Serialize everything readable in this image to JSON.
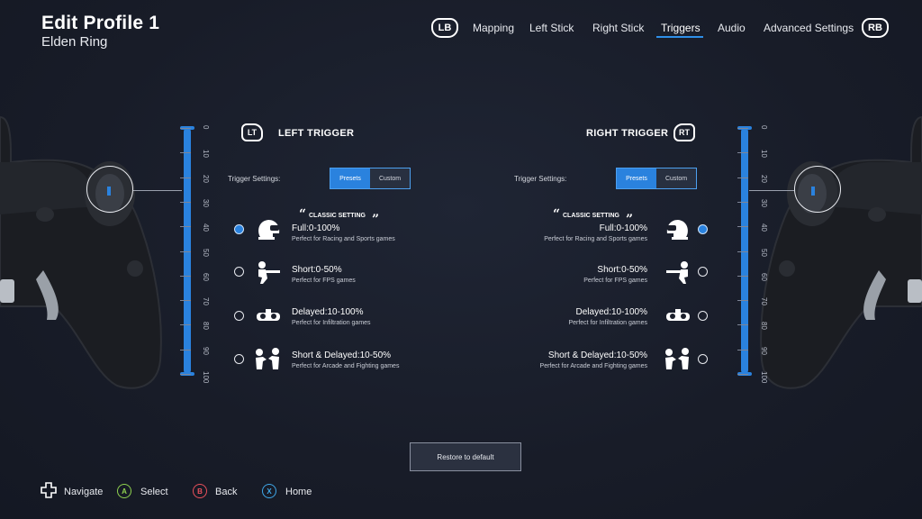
{
  "header": {
    "title": "Edit Profile 1",
    "subtitle": "Elden Ring",
    "lb": "LB",
    "rb": "RB",
    "tabs": [
      {
        "label": "Mapping"
      },
      {
        "label": "Left Stick"
      },
      {
        "label": "Right Stick"
      },
      {
        "label": "Triggers",
        "active": true
      },
      {
        "label": "Audio"
      },
      {
        "label": "Advanced Settings"
      }
    ]
  },
  "scale": [
    "0",
    "10",
    "20",
    "30",
    "40",
    "50",
    "60",
    "70",
    "80",
    "90",
    "100"
  ],
  "left": {
    "badge": "LT",
    "title": "LEFT TRIGGER",
    "settings_label": "Trigger Settings:",
    "presets": "Presets",
    "custom": "Custom",
    "range": [
      0,
      100
    ]
  },
  "right": {
    "badge": "RT",
    "title": "RIGHT TRIGGER",
    "settings_label": "Trigger Settings:",
    "presets": "Presets",
    "custom": "Custom",
    "range": [
      0,
      100
    ]
  },
  "classic_label": "CLASSIC SETTING",
  "options": [
    {
      "title": "Full:0-100%",
      "desc": "Perfect for Racing and Sports games",
      "icon": "racing-helmet-icon"
    },
    {
      "title": "Short:0-50%",
      "desc": "Perfect for FPS games",
      "icon": "soldier-rifle-icon"
    },
    {
      "title": "Delayed:10-100%",
      "desc": "Perfect for Infiltration games",
      "icon": "night-goggles-icon"
    },
    {
      "title": "Short  & Delayed:10-50%",
      "desc": "Perfect for Arcade and Fighting games",
      "icon": "fighters-icon"
    }
  ],
  "right_options": [
    {
      "title": "Full:0-100%"
    },
    {
      "title": "Short:0-50%"
    },
    {
      "title": "Delayed:10-100%"
    },
    {
      "title": "Short  & Delayed:10-50%"
    }
  ],
  "selected_option": 0,
  "restore": "Restore to default",
  "footer": {
    "navigate": "Navigate",
    "a": "A",
    "select": "Select",
    "b": "B",
    "back": "Back",
    "x": "X",
    "home": "Home"
  },
  "colors": {
    "accent": "#2a82de",
    "a_button": "#8fd14f",
    "b_button": "#e8505b",
    "x_button": "#3fa7e8"
  }
}
